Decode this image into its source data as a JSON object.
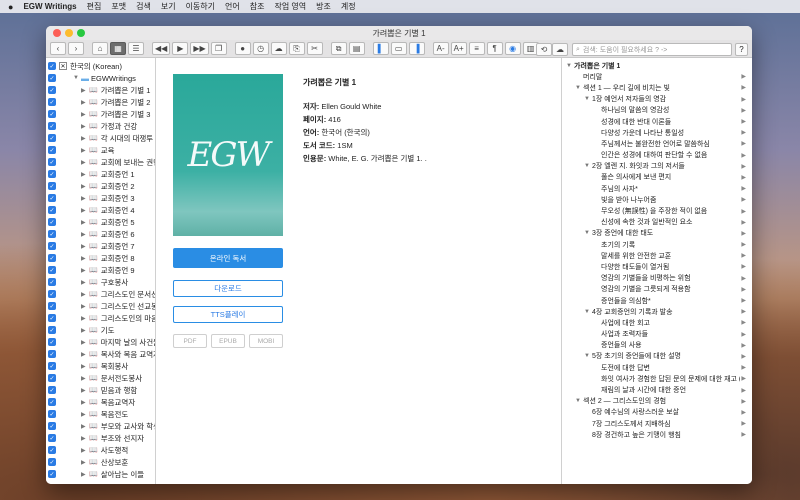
{
  "menubar": {
    "apple": "",
    "app_name": "EGW Writings",
    "items": [
      "편집",
      "포맷",
      "검색",
      "보기",
      "이동하기",
      "언어",
      "참조",
      "작업 영역",
      "방조",
      "계정"
    ]
  },
  "window": {
    "title": "가려뽑은 기별 1"
  },
  "toolbar": {
    "search_placeholder": "검색: 도움이 필요하세요 ? ->",
    "help": "?"
  },
  "tree": {
    "root": "한국의 (Korean)",
    "folder": "EGWWritings",
    "items": [
      "가려뽑은 기별 1",
      "가려뽑은 기별 2",
      "가려뽑은 기별 3",
      "가정과 건강",
      "각 시대의 대쟁투",
      "교육",
      "교회에 보내는 권면",
      "교회증언 1",
      "교회증언 2",
      "교회증언 3",
      "교회증언 4",
      "교회증언 5",
      "교회증언 6",
      "교회증언 7",
      "교회증언 8",
      "교회증언 9",
      "구호봉사",
      "그리스도인 문서선교",
      "그리스도인 선교봉사",
      "그리스도인의 마음과",
      "기도",
      "마지막 날의 사건들",
      "목사와 복음 교역자에",
      "목회봉사",
      "문서전도봉사",
      "믿음과 행함",
      "복음교역자",
      "복음전도",
      "부모와 교사와 학생에",
      "부조와 선지자",
      "사도행적",
      "산상보훈",
      "살아남는 이들"
    ]
  },
  "book": {
    "cover_logo": "EGW",
    "title": "가려뽑은 기별 1",
    "author_label": "저자:",
    "author": "Ellen Gould White",
    "pages_label": "페이지:",
    "pages": "416",
    "language_label": "언어:",
    "language": "한국어 (한국의)",
    "code_label": "도서 코드:",
    "code": "1SM",
    "citation_label": "인용문:",
    "citation": "White, E. G.  가려뽑은 기별 1. .",
    "read_online": "온라인 독서",
    "download": "다운로드",
    "tts": "TTS플레이",
    "formats": [
      "PDF",
      "EPUB",
      "MOBI"
    ]
  },
  "toc": [
    {
      "level": 0,
      "tri": "▼",
      "text": "가려뽑은 기별 1",
      "bold": true,
      "play": false
    },
    {
      "level": 1,
      "tri": "",
      "text": "머리말",
      "play": true
    },
    {
      "level": 1,
      "tri": "▼",
      "text": "섹션 1 — 우리 길에 비치는 빛",
      "play": true
    },
    {
      "level": 2,
      "tri": "▼",
      "text": "1장 예언서 저자들의 영감",
      "play": true
    },
    {
      "level": 3,
      "tri": "",
      "text": "하나님의 말씀의 영감성",
      "play": true
    },
    {
      "level": 3,
      "tri": "",
      "text": "성경에 대한 반대 이론들",
      "play": true
    },
    {
      "level": 3,
      "tri": "",
      "text": "다양성 가운데 나타난 통일성",
      "play": true
    },
    {
      "level": 3,
      "tri": "",
      "text": "주님께서는 불완전한 언어로 말씀하심",
      "play": true
    },
    {
      "level": 3,
      "tri": "",
      "text": "인간은 성경에 대하여 판단할 수 없음",
      "play": true
    },
    {
      "level": 2,
      "tri": "▼",
      "text": "2장 엘렌 지. 화잇과 그의 저서들",
      "play": true
    },
    {
      "level": 3,
      "tri": "",
      "text": "풀슨 의사에게 보낸 편지",
      "play": true
    },
    {
      "level": 3,
      "tri": "",
      "text": "주님의 사자*",
      "play": true
    },
    {
      "level": 3,
      "tri": "",
      "text": "빛을 받아 나누어줌",
      "play": true
    },
    {
      "level": 3,
      "tri": "",
      "text": "무오성 (無誤性) 을 주장한 적이 없음",
      "play": true
    },
    {
      "level": 3,
      "tri": "",
      "text": "신성에 속한 것과 일반적인 요소",
      "play": true
    },
    {
      "level": 2,
      "tri": "▼",
      "text": "3장 증언에 대한 태도",
      "play": true
    },
    {
      "level": 3,
      "tri": "",
      "text": "초기의 기록",
      "play": true
    },
    {
      "level": 3,
      "tri": "",
      "text": "말세를 위한 안전한 교훈",
      "play": true
    },
    {
      "level": 3,
      "tri": "",
      "text": "다양한 태도들이 열거됨",
      "play": true
    },
    {
      "level": 3,
      "tri": "",
      "text": "영감의 기별들을 비평하는 위험",
      "play": true
    },
    {
      "level": 3,
      "tri": "",
      "text": "영감의 기별을 그릇되게 적용함",
      "play": true
    },
    {
      "level": 3,
      "tri": "",
      "text": "증언들을 의심함*",
      "play": true
    },
    {
      "level": 2,
      "tri": "▼",
      "text": "4장 교회증언의 기록과 발송",
      "play": true
    },
    {
      "level": 3,
      "tri": "",
      "text": "사업에 대한 회고",
      "play": true
    },
    {
      "level": 3,
      "tri": "",
      "text": "사업과 조력자들",
      "play": true
    },
    {
      "level": 3,
      "tri": "",
      "text": "증언들의 사용",
      "play": true
    },
    {
      "level": 2,
      "tri": "▼",
      "text": "5장 초기의 증언들에 대한 설명",
      "play": true
    },
    {
      "level": 3,
      "tri": "",
      "text": "도전에 대한 답변",
      "play": true
    },
    {
      "level": 3,
      "tri": "",
      "text": "화잇 여사가 경험한 답된 문의 문제에 대한 재고 (1",
      "play": true
    },
    {
      "level": 3,
      "tri": "",
      "text": "재림의 날과 시간에 대한 증언",
      "play": true
    },
    {
      "level": 1,
      "tri": "▼",
      "text": "섹션 2 — 그리스도인의 경험",
      "play": true
    },
    {
      "level": 2,
      "tri": "",
      "text": "6장 예수님의 사랑스러운 보살",
      "play": true
    },
    {
      "level": 2,
      "tri": "",
      "text": "7장 그리스도께서 지배하심",
      "play": true
    },
    {
      "level": 2,
      "tri": "",
      "text": "8장 경건하고 높은 기맹이 행침",
      "play": true
    }
  ]
}
